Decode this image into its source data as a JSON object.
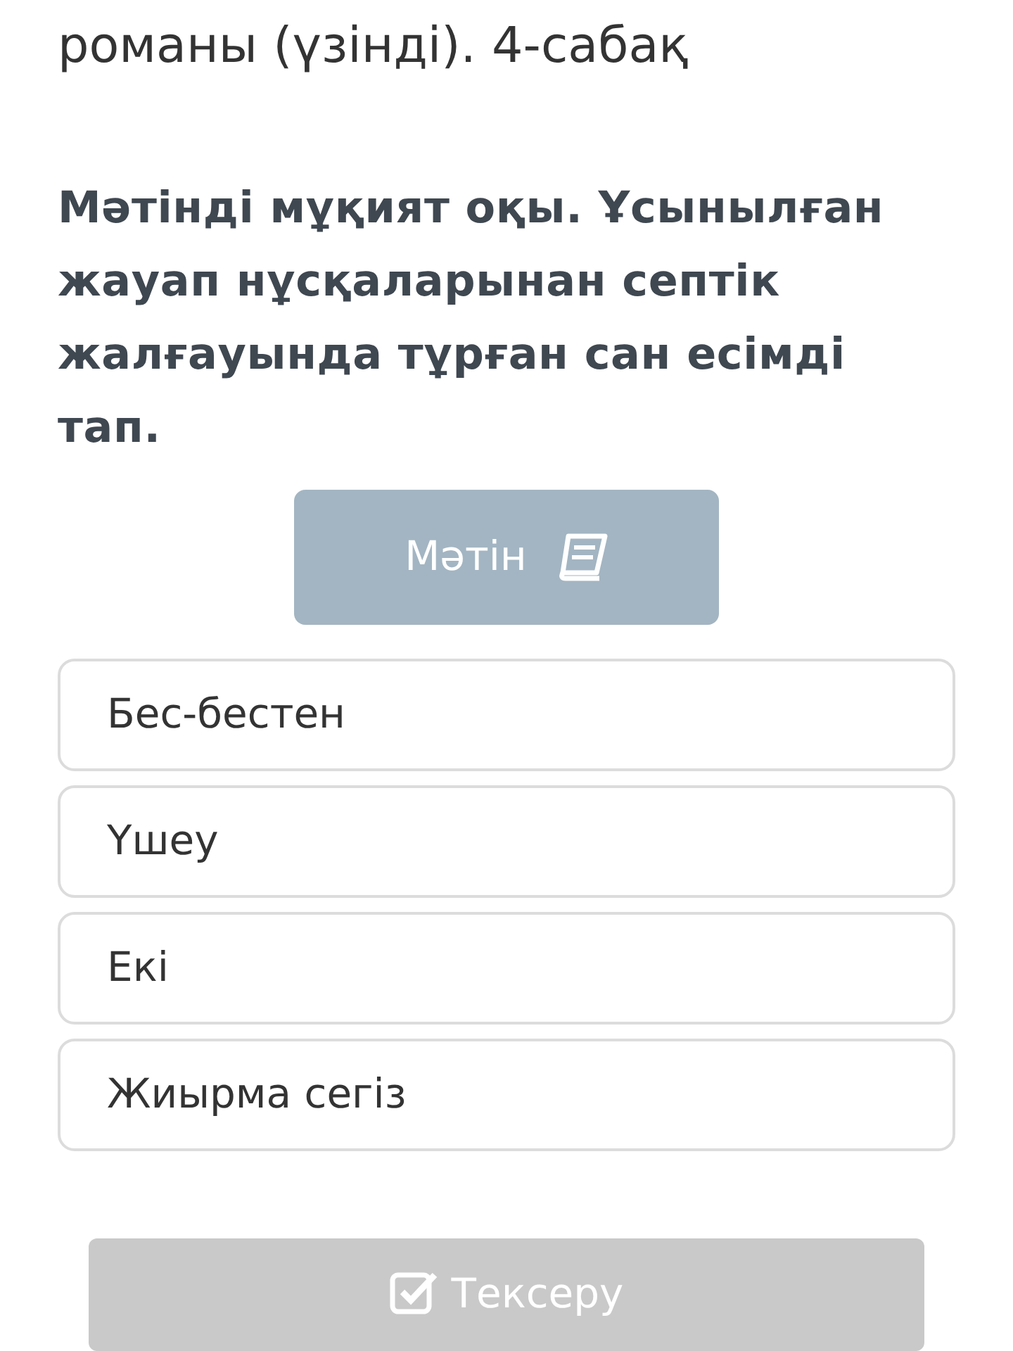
{
  "lesson_title": "романы (үзінді). 4-сабақ",
  "question": "Мәтінді мұқият оқы. Ұсынылған жауап нұсқаларынан септік жалғауында тұрған сан есімді тап.",
  "text_button": {
    "label": "Мәтін"
  },
  "options": [
    {
      "label": "Бес-бестен",
      "selected": false
    },
    {
      "label": "Үшеу",
      "selected": false
    },
    {
      "label": "Екі",
      "selected": false
    },
    {
      "label": "Жиырма сегіз",
      "selected": false
    }
  ],
  "check_button": {
    "label": "Тексеру",
    "disabled": true
  }
}
